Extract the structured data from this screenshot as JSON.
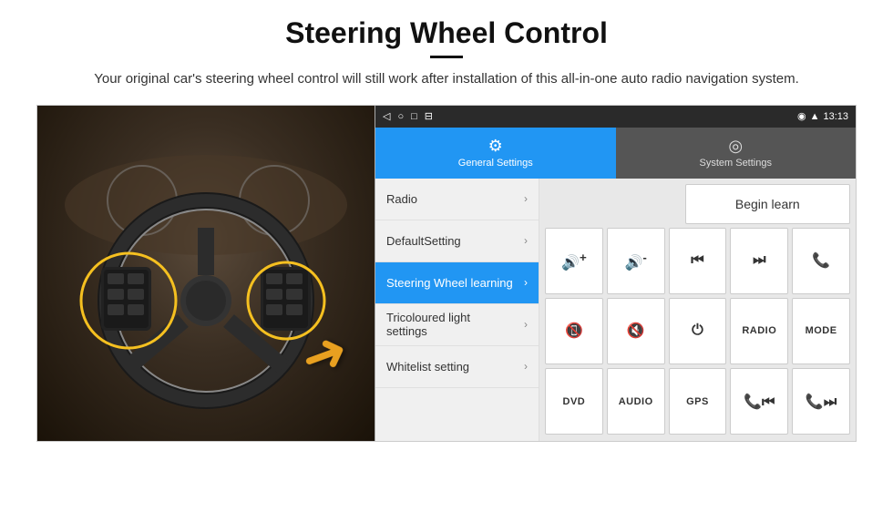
{
  "header": {
    "title": "Steering Wheel Control",
    "subtitle": "Your original car's steering wheel control will still work after installation of this all-in-one auto radio navigation system."
  },
  "statusBar": {
    "time": "13:13",
    "navIcons": [
      "◁",
      "○",
      "□",
      "⊟"
    ]
  },
  "tabs": [
    {
      "label": "General Settings",
      "icon": "⚙",
      "active": true
    },
    {
      "label": "System Settings",
      "icon": "🌐",
      "active": false
    }
  ],
  "menu": [
    {
      "label": "Radio",
      "active": false
    },
    {
      "label": "DefaultSetting",
      "active": false
    },
    {
      "label": "Steering Wheel learning",
      "active": true
    },
    {
      "label": "Tricoloured light settings",
      "active": false
    },
    {
      "label": "Whitelist setting",
      "active": false
    }
  ],
  "controls": {
    "beginLearn": "Begin learn",
    "row1": [
      "🔊+",
      "🔊-",
      "⏮",
      "⏭",
      "📞"
    ],
    "row2": [
      "📞↩",
      "🔇",
      "⏻",
      "RADIO",
      "MODE"
    ],
    "row3": [
      "DVD",
      "AUDIO",
      "GPS",
      "📞⏮",
      "📞⏭"
    ]
  }
}
